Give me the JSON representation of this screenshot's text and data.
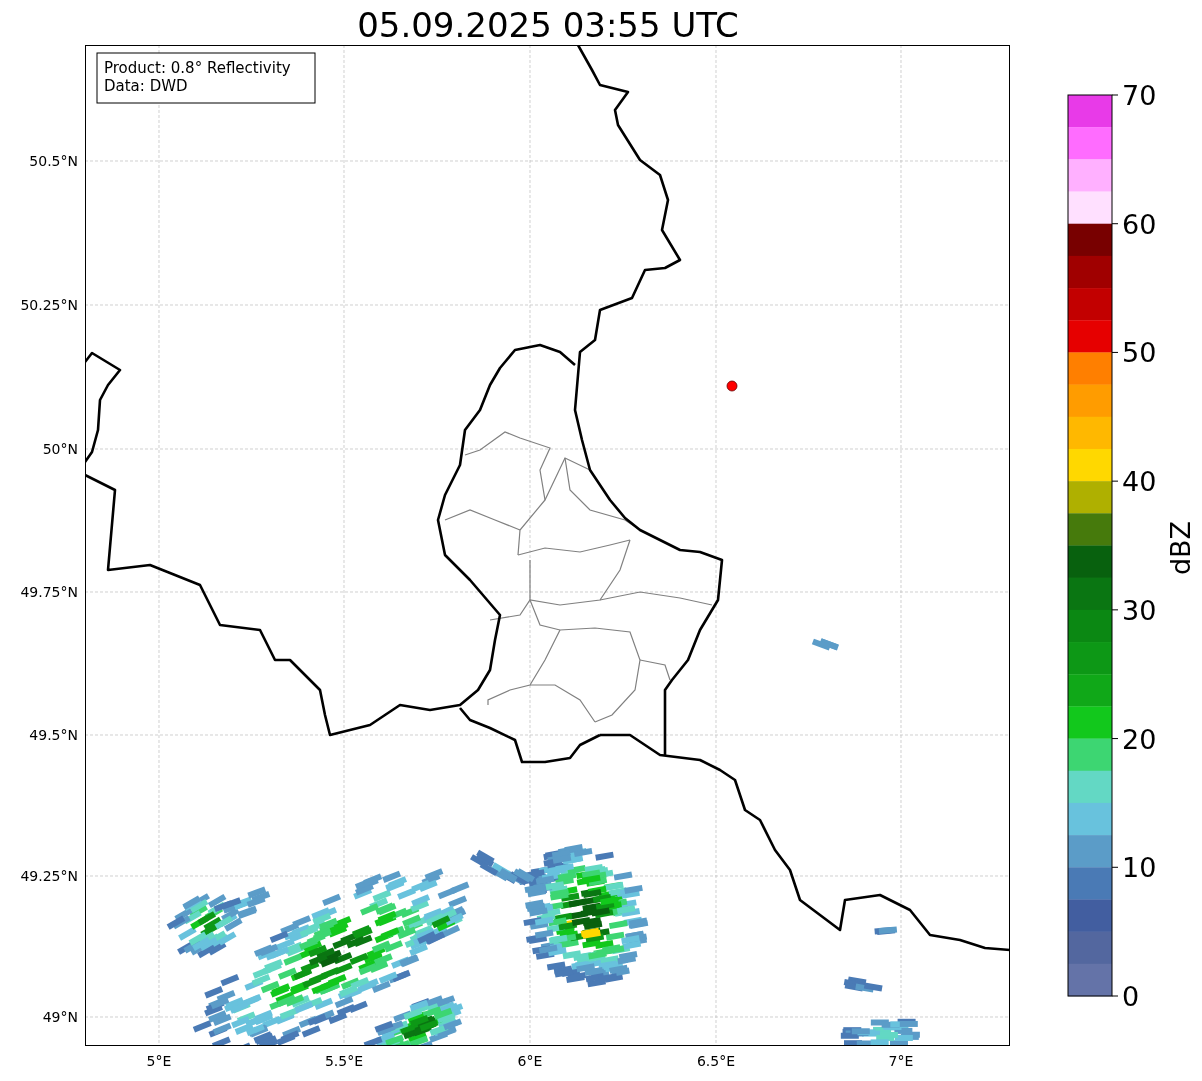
{
  "title": "05.09.2025 03:55 UTC",
  "legend": [
    "Product: 0.8° Reflectivity",
    "Data: DWD"
  ],
  "x_ticks": [
    "5°E",
    "5.5°E",
    "6°E",
    "6.5°E",
    "7°E"
  ],
  "y_ticks": [
    "50.5°N",
    "50.25°N",
    "50°N",
    "49.75°N",
    "49.5°N",
    "49.25°N",
    "49°N"
  ],
  "colorbar": {
    "label": "dBZ",
    "ticks": [
      "70",
      "60",
      "50",
      "40",
      "30",
      "20",
      "10",
      "0"
    ],
    "bands": [
      {
        "color": "#e83ae8"
      },
      {
        "color": "#ff6cff"
      },
      {
        "color": "#ffb0ff"
      },
      {
        "color": "#ffe0ff"
      },
      {
        "color": "#780000"
      },
      {
        "color": "#a00000"
      },
      {
        "color": "#c20000"
      },
      {
        "color": "#e60000"
      },
      {
        "color": "#ff7f00"
      },
      {
        "color": "#ff9c00"
      },
      {
        "color": "#ffb800"
      },
      {
        "color": "#ffd800"
      },
      {
        "color": "#afb000"
      },
      {
        "color": "#467a0c"
      },
      {
        "color": "#08610e"
      },
      {
        "color": "#0a7612"
      },
      {
        "color": "#0b8813"
      },
      {
        "color": "#0d9816"
      },
      {
        "color": "#10a818"
      },
      {
        "color": "#12c81c"
      },
      {
        "color": "#3dd672"
      },
      {
        "color": "#63d8c4"
      },
      {
        "color": "#68c2dd"
      },
      {
        "color": "#5b9cc8"
      },
      {
        "color": "#4a7ab5"
      },
      {
        "color": "#425ea0"
      },
      {
        "color": "#53679f"
      },
      {
        "color": "#6473a8"
      }
    ]
  }
}
